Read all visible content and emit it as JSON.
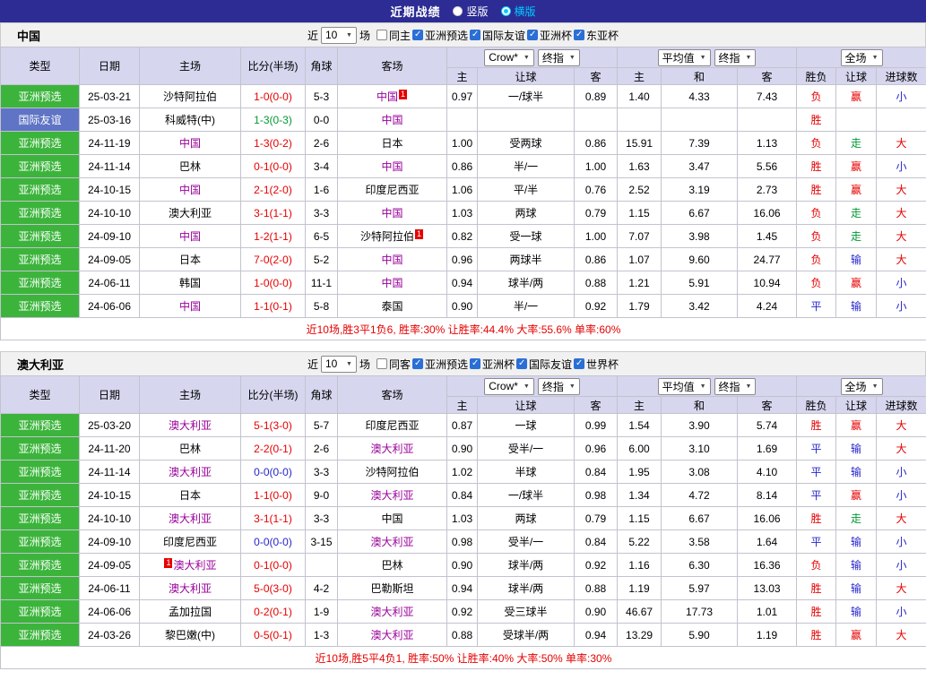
{
  "topbar": {
    "title": "近期战绩",
    "options": [
      {
        "label": "竖版",
        "selected": false
      },
      {
        "label": "横版",
        "selected": true
      }
    ]
  },
  "table_header": {
    "cols": [
      "类型",
      "日期",
      "主场",
      "比分(半场)",
      "角球",
      "客场"
    ],
    "odds_group": {
      "bookmaker": "Crow*",
      "final": "终指"
    },
    "avg_group": {
      "average": "平均值",
      "final": "终指"
    },
    "full_group": {
      "label": "全场"
    },
    "sub": [
      "主",
      "让球",
      "客",
      "主",
      "和",
      "客",
      "胜负",
      "让球",
      "进球数"
    ]
  },
  "sections": [
    {
      "team": "中国",
      "filters": {
        "prefix": "近",
        "count": "10",
        "suffix": "场",
        "checkboxes": [
          {
            "label": "同主",
            "checked": false
          },
          {
            "label": "亚洲预选",
            "checked": true
          },
          {
            "label": "国际友谊",
            "checked": true
          },
          {
            "label": "亚洲杯",
            "checked": true
          },
          {
            "label": "东亚杯",
            "checked": true
          }
        ]
      },
      "rows": [
        {
          "type": "亚洲预选",
          "type_color": "green",
          "date": "25-03-21",
          "home": "沙特阿拉伯",
          "home_focus": false,
          "home_badge": "",
          "score": "1-0(0-0)",
          "score_color": "red",
          "corner": "5-3",
          "away": "中国",
          "away_focus": true,
          "away_badge": "1",
          "odds_home": "0.97",
          "handicap": "一/球半",
          "odds_away": "0.89",
          "avg_home": "1.40",
          "avg_draw": "4.33",
          "avg_away": "7.43",
          "result": "负",
          "result_color": "red",
          "handicap_result": "赢",
          "handicap_result_color": "red",
          "goals": "小",
          "goals_color": "blue"
        },
        {
          "type": "国际友谊",
          "type_color": "blue",
          "date": "25-03-16",
          "home": "科威特(中)",
          "home_focus": false,
          "home_badge": "",
          "score": "1-3(0-3)",
          "score_color": "green",
          "corner": "0-0",
          "away": "中国",
          "away_focus": true,
          "away_badge": "",
          "odds_home": "",
          "handicap": "",
          "odds_away": "",
          "avg_home": "",
          "avg_draw": "",
          "avg_away": "",
          "result": "胜",
          "result_color": "red",
          "handicap_result": "",
          "handicap_result_color": "",
          "goals": "",
          "goals_color": ""
        },
        {
          "type": "亚洲预选",
          "type_color": "green",
          "date": "24-11-19",
          "home": "中国",
          "home_focus": true,
          "home_badge": "",
          "score": "1-3(0-2)",
          "score_color": "red",
          "corner": "2-6",
          "away": "日本",
          "away_focus": false,
          "away_badge": "",
          "odds_home": "1.00",
          "handicap": "受两球",
          "odds_away": "0.86",
          "avg_home": "15.91",
          "avg_draw": "7.39",
          "avg_away": "1.13",
          "result": "负",
          "result_color": "red",
          "handicap_result": "走",
          "handicap_result_color": "green",
          "goals": "大",
          "goals_color": "red"
        },
        {
          "type": "亚洲预选",
          "type_color": "green",
          "date": "24-11-14",
          "home": "巴林",
          "home_focus": false,
          "home_badge": "",
          "score": "0-1(0-0)",
          "score_color": "red",
          "corner": "3-4",
          "away": "中国",
          "away_focus": true,
          "away_badge": "",
          "odds_home": "0.86",
          "handicap": "半/一",
          "odds_away": "1.00",
          "avg_home": "1.63",
          "avg_draw": "3.47",
          "avg_away": "5.56",
          "result": "胜",
          "result_color": "red",
          "handicap_result": "赢",
          "handicap_result_color": "red",
          "goals": "小",
          "goals_color": "blue"
        },
        {
          "type": "亚洲预选",
          "type_color": "green",
          "date": "24-10-15",
          "home": "中国",
          "home_focus": true,
          "home_badge": "",
          "score": "2-1(2-0)",
          "score_color": "red",
          "corner": "1-6",
          "away": "印度尼西亚",
          "away_focus": false,
          "away_badge": "",
          "odds_home": "1.06",
          "handicap": "平/半",
          "odds_away": "0.76",
          "avg_home": "2.52",
          "avg_draw": "3.19",
          "avg_away": "2.73",
          "result": "胜",
          "result_color": "red",
          "handicap_result": "赢",
          "handicap_result_color": "red",
          "goals": "大",
          "goals_color": "red"
        },
        {
          "type": "亚洲预选",
          "type_color": "green",
          "date": "24-10-10",
          "home": "澳大利亚",
          "home_focus": false,
          "home_badge": "",
          "score": "3-1(1-1)",
          "score_color": "red",
          "corner": "3-3",
          "away": "中国",
          "away_focus": true,
          "away_badge": "",
          "odds_home": "1.03",
          "handicap": "两球",
          "odds_away": "0.79",
          "avg_home": "1.15",
          "avg_draw": "6.67",
          "avg_away": "16.06",
          "result": "负",
          "result_color": "red",
          "handicap_result": "走",
          "handicap_result_color": "green",
          "goals": "大",
          "goals_color": "red"
        },
        {
          "type": "亚洲预选",
          "type_color": "green",
          "date": "24-09-10",
          "home": "中国",
          "home_focus": true,
          "home_badge": "",
          "score": "1-2(1-1)",
          "score_color": "red",
          "corner": "6-5",
          "away": "沙特阿拉伯",
          "away_focus": false,
          "away_badge": "1",
          "odds_home": "0.82",
          "handicap": "受一球",
          "odds_away": "1.00",
          "avg_home": "7.07",
          "avg_draw": "3.98",
          "avg_away": "1.45",
          "result": "负",
          "result_color": "red",
          "handicap_result": "走",
          "handicap_result_color": "green",
          "goals": "大",
          "goals_color": "red"
        },
        {
          "type": "亚洲预选",
          "type_color": "green",
          "date": "24-09-05",
          "home": "日本",
          "home_focus": false,
          "home_badge": "",
          "score": "7-0(2-0)",
          "score_color": "red",
          "corner": "5-2",
          "away": "中国",
          "away_focus": true,
          "away_badge": "",
          "odds_home": "0.96",
          "handicap": "两球半",
          "odds_away": "0.86",
          "avg_home": "1.07",
          "avg_draw": "9.60",
          "avg_away": "24.77",
          "result": "负",
          "result_color": "red",
          "handicap_result": "输",
          "handicap_result_color": "blue",
          "goals": "大",
          "goals_color": "red"
        },
        {
          "type": "亚洲预选",
          "type_color": "green",
          "date": "24-06-11",
          "home": "韩国",
          "home_focus": false,
          "home_badge": "",
          "score": "1-0(0-0)",
          "score_color": "red",
          "corner": "11-1",
          "away": "中国",
          "away_focus": true,
          "away_badge": "",
          "odds_home": "0.94",
          "handicap": "球半/两",
          "odds_away": "0.88",
          "avg_home": "1.21",
          "avg_draw": "5.91",
          "avg_away": "10.94",
          "result": "负",
          "result_color": "red",
          "handicap_result": "赢",
          "handicap_result_color": "red",
          "goals": "小",
          "goals_color": "blue"
        },
        {
          "type": "亚洲预选",
          "type_color": "green",
          "date": "24-06-06",
          "home": "中国",
          "home_focus": true,
          "home_badge": "",
          "score": "1-1(0-1)",
          "score_color": "red",
          "corner": "5-8",
          "away": "泰国",
          "away_focus": false,
          "away_badge": "",
          "odds_home": "0.90",
          "handicap": "半/一",
          "odds_away": "0.92",
          "avg_home": "1.79",
          "avg_draw": "3.42",
          "avg_away": "4.24",
          "result": "平",
          "result_color": "blue",
          "handicap_result": "输",
          "handicap_result_color": "blue",
          "goals": "小",
          "goals_color": "blue"
        }
      ],
      "summary": "近10场,胜3平1负6, 胜率:30% 让胜率:44.4% 大率:55.6% 单率:60%"
    },
    {
      "team": "澳大利亚",
      "filters": {
        "prefix": "近",
        "count": "10",
        "suffix": "场",
        "checkboxes": [
          {
            "label": "同客",
            "checked": false
          },
          {
            "label": "亚洲预选",
            "checked": true
          },
          {
            "label": "亚洲杯",
            "checked": true
          },
          {
            "label": "国际友谊",
            "checked": true
          },
          {
            "label": "世界杯",
            "checked": true
          }
        ]
      },
      "rows": [
        {
          "type": "亚洲预选",
          "type_color": "green",
          "date": "25-03-20",
          "home": "澳大利亚",
          "home_focus": true,
          "home_badge": "",
          "score": "5-1(3-0)",
          "score_color": "red",
          "corner": "5-7",
          "away": "印度尼西亚",
          "away_focus": false,
          "away_badge": "",
          "odds_home": "0.87",
          "handicap": "一球",
          "odds_away": "0.99",
          "avg_home": "1.54",
          "avg_draw": "3.90",
          "avg_away": "5.74",
          "result": "胜",
          "result_color": "red",
          "handicap_result": "赢",
          "handicap_result_color": "red",
          "goals": "大",
          "goals_color": "red"
        },
        {
          "type": "亚洲预选",
          "type_color": "green",
          "date": "24-11-20",
          "home": "巴林",
          "home_focus": false,
          "home_badge": "",
          "score": "2-2(0-1)",
          "score_color": "red",
          "corner": "2-6",
          "away": "澳大利亚",
          "away_focus": true,
          "away_badge": "",
          "odds_home": "0.90",
          "handicap": "受半/一",
          "odds_away": "0.96",
          "avg_home": "6.00",
          "avg_draw": "3.10",
          "avg_away": "1.69",
          "result": "平",
          "result_color": "blue",
          "handicap_result": "输",
          "handicap_result_color": "blue",
          "goals": "大",
          "goals_color": "red"
        },
        {
          "type": "亚洲预选",
          "type_color": "green",
          "date": "24-11-14",
          "home": "澳大利亚",
          "home_focus": true,
          "home_badge": "",
          "score": "0-0(0-0)",
          "score_color": "blue",
          "corner": "3-3",
          "away": "沙特阿拉伯",
          "away_focus": false,
          "away_badge": "",
          "odds_home": "1.02",
          "handicap": "半球",
          "odds_away": "0.84",
          "avg_home": "1.95",
          "avg_draw": "3.08",
          "avg_away": "4.10",
          "result": "平",
          "result_color": "blue",
          "handicap_result": "输",
          "handicap_result_color": "blue",
          "goals": "小",
          "goals_color": "blue"
        },
        {
          "type": "亚洲预选",
          "type_color": "green",
          "date": "24-10-15",
          "home": "日本",
          "home_focus": false,
          "home_badge": "",
          "score": "1-1(0-0)",
          "score_color": "red",
          "corner": "9-0",
          "away": "澳大利亚",
          "away_focus": true,
          "away_badge": "",
          "odds_home": "0.84",
          "handicap": "一/球半",
          "odds_away": "0.98",
          "avg_home": "1.34",
          "avg_draw": "4.72",
          "avg_away": "8.14",
          "result": "平",
          "result_color": "blue",
          "handicap_result": "赢",
          "handicap_result_color": "red",
          "goals": "小",
          "goals_color": "blue"
        },
        {
          "type": "亚洲预选",
          "type_color": "green",
          "date": "24-10-10",
          "home": "澳大利亚",
          "home_focus": true,
          "home_badge": "",
          "score": "3-1(1-1)",
          "score_color": "red",
          "corner": "3-3",
          "away": "中国",
          "away_focus": false,
          "away_badge": "",
          "odds_home": "1.03",
          "handicap": "两球",
          "odds_away": "0.79",
          "avg_home": "1.15",
          "avg_draw": "6.67",
          "avg_away": "16.06",
          "result": "胜",
          "result_color": "red",
          "handicap_result": "走",
          "handicap_result_color": "green",
          "goals": "大",
          "goals_color": "red"
        },
        {
          "type": "亚洲预选",
          "type_color": "green",
          "date": "24-09-10",
          "home": "印度尼西亚",
          "home_focus": false,
          "home_badge": "",
          "score": "0-0(0-0)",
          "score_color": "blue",
          "corner": "3-15",
          "away": "澳大利亚",
          "away_focus": true,
          "away_badge": "",
          "odds_home": "0.98",
          "handicap": "受半/一",
          "odds_away": "0.84",
          "avg_home": "5.22",
          "avg_draw": "3.58",
          "avg_away": "1.64",
          "result": "平",
          "result_color": "blue",
          "handicap_result": "输",
          "handicap_result_color": "blue",
          "goals": "小",
          "goals_color": "blue"
        },
        {
          "type": "亚洲预选",
          "type_color": "green",
          "date": "24-09-05",
          "home": "澳大利亚",
          "home_focus": true,
          "home_badge": "1",
          "home_badge_pos": "before",
          "score": "0-1(0-0)",
          "score_color": "red",
          "corner": "",
          "away": "巴林",
          "away_focus": false,
          "away_badge": "",
          "odds_home": "0.90",
          "handicap": "球半/两",
          "odds_away": "0.92",
          "avg_home": "1.16",
          "avg_draw": "6.30",
          "avg_away": "16.36",
          "result": "负",
          "result_color": "red",
          "handicap_result": "输",
          "handicap_result_color": "blue",
          "goals": "小",
          "goals_color": "blue"
        },
        {
          "type": "亚洲预选",
          "type_color": "green",
          "date": "24-06-11",
          "home": "澳大利亚",
          "home_focus": true,
          "home_badge": "",
          "score": "5-0(3-0)",
          "score_color": "red",
          "corner": "4-2",
          "away": "巴勒斯坦",
          "away_focus": false,
          "away_badge": "",
          "odds_home": "0.94",
          "handicap": "球半/两",
          "odds_away": "0.88",
          "avg_home": "1.19",
          "avg_draw": "5.97",
          "avg_away": "13.03",
          "result": "胜",
          "result_color": "red",
          "handicap_result": "输",
          "handicap_result_color": "blue",
          "goals": "大",
          "goals_color": "red"
        },
        {
          "type": "亚洲预选",
          "type_color": "green",
          "date": "24-06-06",
          "home": "孟加拉国",
          "home_focus": false,
          "home_badge": "",
          "score": "0-2(0-1)",
          "score_color": "red",
          "corner": "1-9",
          "away": "澳大利亚",
          "away_focus": true,
          "away_badge": "",
          "odds_home": "0.92",
          "handicap": "受三球半",
          "odds_away": "0.90",
          "avg_home": "46.67",
          "avg_draw": "17.73",
          "avg_away": "1.01",
          "result": "胜",
          "result_color": "red",
          "handicap_result": "输",
          "handicap_result_color": "blue",
          "goals": "小",
          "goals_color": "blue"
        },
        {
          "type": "亚洲预选",
          "type_color": "green",
          "date": "24-03-26",
          "home": "黎巴嫩(中)",
          "home_focus": false,
          "home_badge": "",
          "score": "0-5(0-1)",
          "score_color": "red",
          "corner": "1-3",
          "away": "澳大利亚",
          "away_focus": true,
          "away_badge": "",
          "odds_home": "0.88",
          "handicap": "受球半/两",
          "odds_away": "0.94",
          "avg_home": "13.29",
          "avg_draw": "5.90",
          "avg_away": "1.19",
          "result": "胜",
          "result_color": "red",
          "handicap_result": "赢",
          "handicap_result_color": "red",
          "goals": "大",
          "goals_color": "red"
        }
      ],
      "summary": "近10场,胜5平4负1, 胜率:50% 让胜率:40% 大率:50% 单率:30%"
    }
  ]
}
